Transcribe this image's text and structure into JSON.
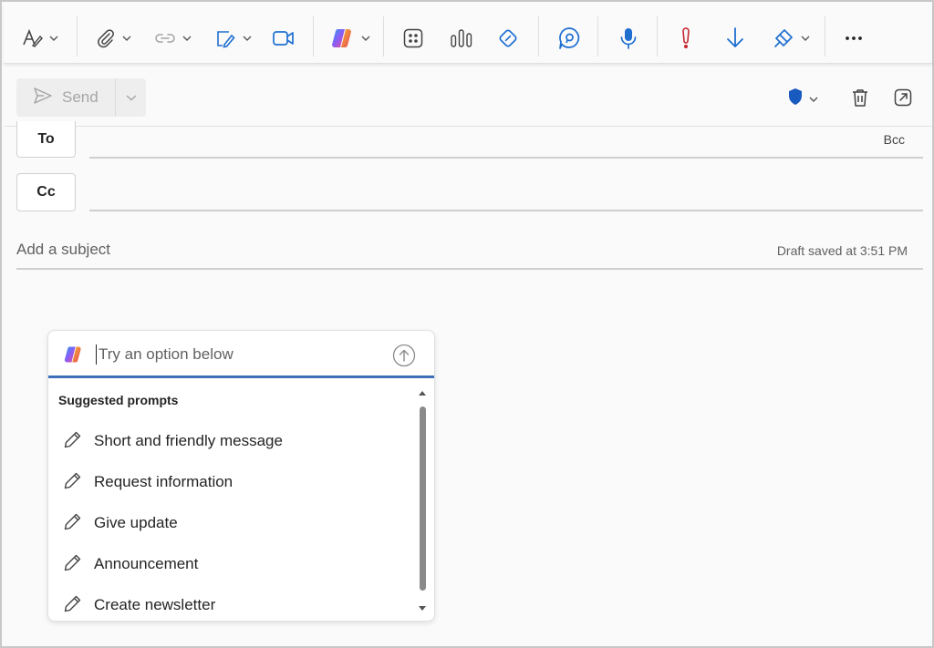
{
  "toolbar": {
    "items": [
      {
        "name": "format-text-icon"
      },
      {
        "name": "attach-file-icon"
      },
      {
        "name": "link-icon"
      },
      {
        "name": "signature-icon"
      },
      {
        "name": "teams-meeting-icon"
      },
      {
        "name": "copilot-icon"
      },
      {
        "name": "apps-icon"
      },
      {
        "name": "poll-icon"
      },
      {
        "name": "editor-icon"
      },
      {
        "name": "viva-icon"
      },
      {
        "name": "dictate-icon"
      },
      {
        "name": "high-importance-icon"
      },
      {
        "name": "low-importance-icon"
      },
      {
        "name": "sensitivity-icon"
      },
      {
        "name": "more-options-icon"
      }
    ]
  },
  "compose": {
    "send_label": "Send",
    "to_label": "To",
    "cc_label": "Cc",
    "bcc_label": "Bcc",
    "subject_placeholder": "Add a subject",
    "draft_status": "Draft saved at 3:51 PM"
  },
  "copilot": {
    "input_placeholder": "Try an option below",
    "suggested_title": "Suggested prompts",
    "prompts": [
      {
        "label": "Short and friendly message"
      },
      {
        "label": "Request information"
      },
      {
        "label": "Give update"
      },
      {
        "label": "Announcement"
      },
      {
        "label": "Create newsletter"
      }
    ]
  },
  "colors": {
    "accent_blue": "#1f6fd1",
    "importance_red": "#c4262e",
    "panel_accent": "#3f6fb8",
    "shield_blue": "#185abd"
  }
}
